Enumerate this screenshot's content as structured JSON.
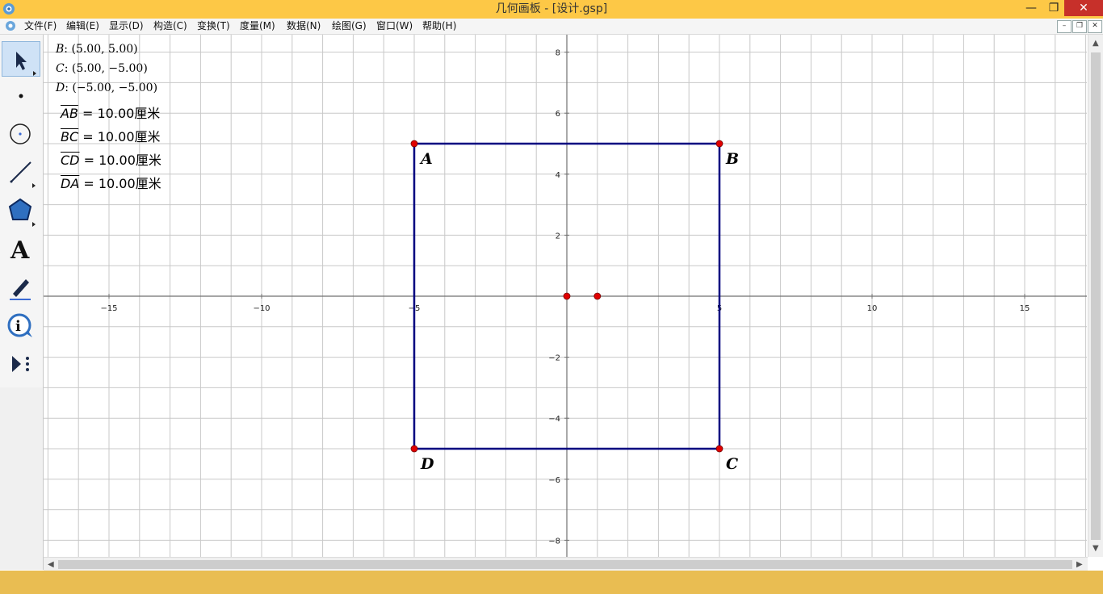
{
  "window": {
    "title": "几何画板 - [设计.gsp]",
    "min": "—",
    "max": "❐",
    "close": "✕"
  },
  "menu": {
    "items": [
      "文件(F)",
      "编辑(E)",
      "显示(D)",
      "构造(C)",
      "变换(T)",
      "度量(M)",
      "数据(N)",
      "绘图(G)",
      "窗口(W)",
      "帮助(H)"
    ]
  },
  "tools": [
    "arrow-tool",
    "point-tool",
    "compass-tool",
    "straightedge-tool",
    "polygon-tool",
    "text-tool",
    "marker-tool",
    "information-tool",
    "custom-tool"
  ],
  "text_tool_label": "A",
  "coords": [
    {
      "pt": "B",
      "val": ": (5.00, 5.00)"
    },
    {
      "pt": "C",
      "val": ": (5.00, −5.00)"
    },
    {
      "pt": "D",
      "val": ": (−5.00, −5.00)"
    }
  ],
  "measures": [
    {
      "seg": "AB",
      "val": " = 10.00厘米"
    },
    {
      "seg": "BC",
      "val": " = 10.00厘米"
    },
    {
      "seg": "CD",
      "val": " = 10.00厘米"
    },
    {
      "seg": "DA",
      "val": " = 10.00厘米"
    }
  ],
  "graph": {
    "x_ticks": [
      -15,
      -10,
      -5,
      5,
      10,
      15
    ],
    "y_ticks": [
      8,
      6,
      4,
      2,
      -2,
      -4,
      -6,
      -8
    ],
    "x_tick_labels": [
      "−15",
      "−10",
      "−5",
      "5",
      "10",
      "15"
    ],
    "y_tick_labels": [
      "8",
      "6",
      "4",
      "2",
      "−2",
      "−4",
      "−6",
      "−8"
    ],
    "x_range": [
      -17,
      17
    ],
    "y_range": [
      -8.5,
      8.5
    ],
    "square": [
      {
        "label": "A",
        "x": -5,
        "y": 5
      },
      {
        "label": "B",
        "x": 5,
        "y": 5
      },
      {
        "label": "C",
        "x": 5,
        "y": -5
      },
      {
        "label": "D",
        "x": -5,
        "y": -5
      }
    ],
    "extra_points": [
      {
        "x": 0,
        "y": 0
      },
      {
        "x": 1,
        "y": 0
      }
    ],
    "colors": {
      "square": "#000080",
      "point": "#e00000",
      "grid": "#c8c8c8",
      "axis": "#707070"
    }
  }
}
